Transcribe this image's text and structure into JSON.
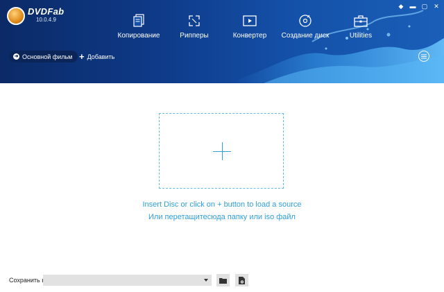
{
  "app": {
    "logo_name": "DVDFab",
    "version": "10.0.4.9"
  },
  "window_controls": {
    "pin": "◆",
    "minimize": "▬",
    "restore": "▢",
    "close": "✕"
  },
  "nav": [
    {
      "label": "Копирование",
      "icon": "copy-icon"
    },
    {
      "label": "Рипперы",
      "icon": "ripper-icon"
    },
    {
      "label": "Конвертер",
      "icon": "converter-icon"
    },
    {
      "label": "Создание диск",
      "icon": "disc-creator-icon"
    },
    {
      "label": "Utilities",
      "icon": "toolbox-icon"
    }
  ],
  "toolbar": {
    "mode_label": "Основной фильм",
    "add_label": "Добавить",
    "add_symbol": "+"
  },
  "main": {
    "hint_line1": "Insert Disc or click on + button to load a source",
    "hint_line2": "Или перетащитесюда папку или iso файл"
  },
  "footer": {
    "save_label": "Сохранить в:",
    "save_path": ""
  },
  "colors": {
    "accent": "#2f9fdb",
    "header_dark": "#0b2a66",
    "header_light": "#1a5fb8"
  }
}
